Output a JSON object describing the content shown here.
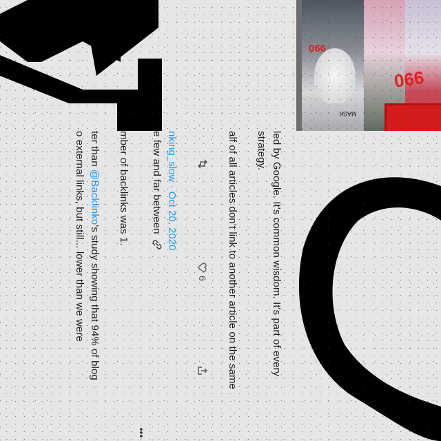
{
  "tweet": {
    "line1": "led by Google. It's common wisdom. It's part of every",
    "line2": "strategy.",
    "line3": "alf of all articles don't link to another article on the same",
    "handle": "nking_slow",
    "date": "Oct 20, 2020",
    "line4": "e few and far between",
    "line5": "mber of backlinks was 1.",
    "line6_before": "ter than ",
    "mention": "@Backlinko",
    "line6_after": "'s study showing that 94% of blog",
    "line7": "o external links, but still... lower than we were",
    "like_count": "6"
  },
  "photo": {
    "price_tag_small": "066",
    "price_tag_large": "066",
    "label": "MASK"
  },
  "icons": {
    "retweet": "retweet-icon",
    "like": "heart-icon",
    "share": "share-icon",
    "link": "link-icon",
    "more": "more-icon"
  },
  "colors": {
    "link_blue": "#1d9bf0",
    "background": "#e6e6e7",
    "ink": "#000000"
  }
}
